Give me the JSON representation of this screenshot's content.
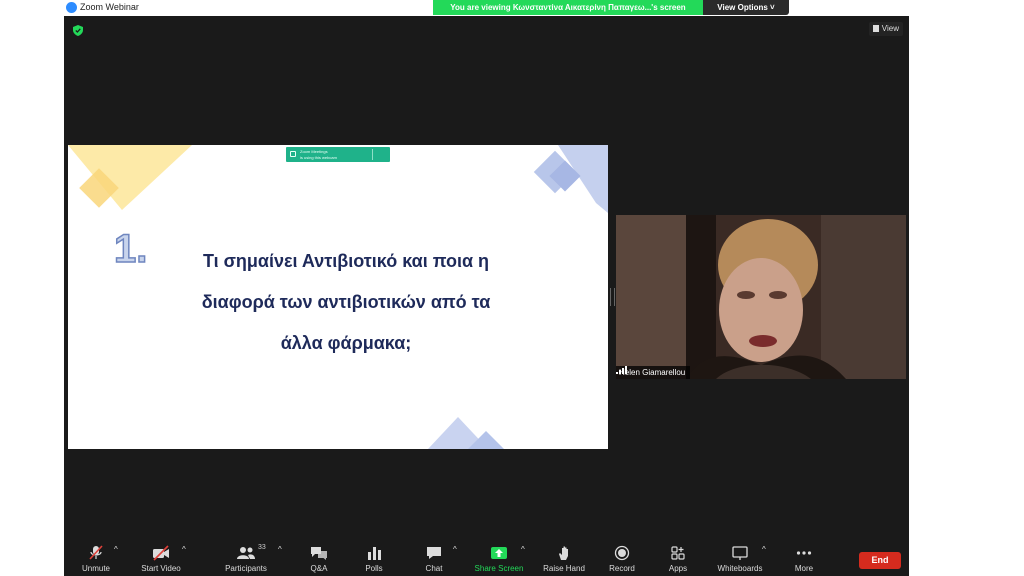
{
  "window": {
    "app_title": "Zoom Webinar"
  },
  "share_banner": {
    "text": "You are viewing Κωνσταντίνα Αικατερίνη Παπαγεω...'s screen",
    "view_options": "View Options"
  },
  "view_button": {
    "label": "View"
  },
  "slide": {
    "zoom_mini_line1": "Zoom Meetings",
    "zoom_mini_line2": "is using this webcam",
    "number": "1.",
    "text_lines": [
      "Τι σημαίνει Αντιβιοτικό και ποια η",
      "διαφορά των αντιβιοτικών από τα",
      "άλλα φάρμακα;"
    ]
  },
  "speaker": {
    "name": "Helen Giamarellou"
  },
  "toolbar": {
    "items": [
      {
        "label": "Unmute",
        "icon": "mic-muted-icon"
      },
      {
        "label": "Start Video",
        "icon": "video-off-icon"
      },
      {
        "label": "Participants",
        "icon": "participants-icon",
        "count": "33"
      },
      {
        "label": "Q&A",
        "icon": "qa-icon"
      },
      {
        "label": "Polls",
        "icon": "polls-icon"
      },
      {
        "label": "Chat",
        "icon": "chat-icon"
      },
      {
        "label": "Share Screen",
        "icon": "share-screen-icon"
      },
      {
        "label": "Raise Hand",
        "icon": "raise-hand-icon"
      },
      {
        "label": "Record",
        "icon": "record-icon"
      },
      {
        "label": "Apps",
        "icon": "apps-icon"
      },
      {
        "label": "Whiteboards",
        "icon": "whiteboard-icon"
      },
      {
        "label": "More",
        "icon": "more-icon"
      }
    ],
    "end_label": "End"
  },
  "colors": {
    "share_green": "#23d959",
    "end_red": "#d52b1e",
    "stage_bg": "#1a1a1a",
    "slide_text": "#1e2a5a"
  }
}
